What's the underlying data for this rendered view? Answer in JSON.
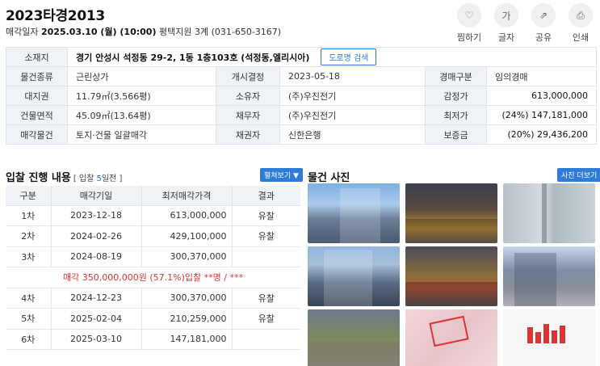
{
  "case": {
    "title": "2023타경2013",
    "sale_date_label": "매각일자",
    "sale_date": "2025.03.10 (월) (10:00)",
    "court": "평택지원 3계 (031-650-3167)"
  },
  "actions": [
    {
      "label": "찜하기",
      "icon": "heart-icon",
      "glyph": "♡"
    },
    {
      "label": "글자",
      "icon": "text-size-icon",
      "glyph": "가"
    },
    {
      "label": "공유",
      "icon": "share-icon",
      "glyph": "⇗"
    },
    {
      "label": "인쇄",
      "icon": "print-icon",
      "glyph": "⎙"
    }
  ],
  "info": {
    "address_label": "소재지",
    "address": "경기 안성시 석정동 29-2, 1동 1층103호 (석정동,엘리시아)",
    "map_button": "도로명 검색",
    "rows": [
      [
        {
          "k": "물건종류",
          "v": "근린상가"
        },
        {
          "k": "개시결정",
          "v": "2023-05-18"
        },
        {
          "k": "경매구분",
          "v": "임의경매"
        }
      ],
      [
        {
          "k": "대지권",
          "v": "11.79㎡(3.566평)"
        },
        {
          "k": "소유자",
          "v": "(주)우진전기"
        },
        {
          "k": "감정가",
          "v": "613,000,000"
        }
      ],
      [
        {
          "k": "건물면적",
          "v": "45.09㎡(13.64평)"
        },
        {
          "k": "채무자",
          "v": "(주)우진전기"
        },
        {
          "k": "최저가",
          "v": "(24%) 147,181,000"
        }
      ],
      [
        {
          "k": "매각물건",
          "v": "토지·건물 일괄매각"
        },
        {
          "k": "채권자",
          "v": "신한은행"
        },
        {
          "k": "보증금",
          "v": "(20%) 29,436,200"
        }
      ]
    ]
  },
  "bidding": {
    "title": "입찰 진행 내용",
    "sub_prefix": "[ 입찰 ",
    "sub_num": "5",
    "sub_suffix": "일전 ]",
    "toggle_button": "펼쳐보기 ▼",
    "headers": [
      "구분",
      "매각기일",
      "최저매각가격",
      "결과"
    ],
    "rows": [
      [
        "1차",
        "2023-12-18",
        "613,000,000",
        "유찰"
      ],
      [
        "2차",
        "2024-02-26",
        "429,100,000",
        "유찰"
      ],
      [
        "3차",
        "2024-08-19",
        "300,370,000",
        ""
      ],
      [
        "4차",
        "2024-12-23",
        "300,370,000",
        "유찰"
      ],
      [
        "5차",
        "2025-02-04",
        "210,259,000",
        "유찰"
      ],
      [
        "6차",
        "2025-03-10",
        "147,181,000",
        ""
      ]
    ],
    "sale_note": "매각 350,000,000원 (57.1%)입찰 **명 / ***"
  },
  "photos": {
    "title": "물건 사진",
    "more_button": "사진 더보기"
  },
  "colors": {
    "accent": "#2f7bd9",
    "highlight": "#1d6fd8",
    "note": "#dd3333",
    "header_bg": "#eff3f8"
  }
}
